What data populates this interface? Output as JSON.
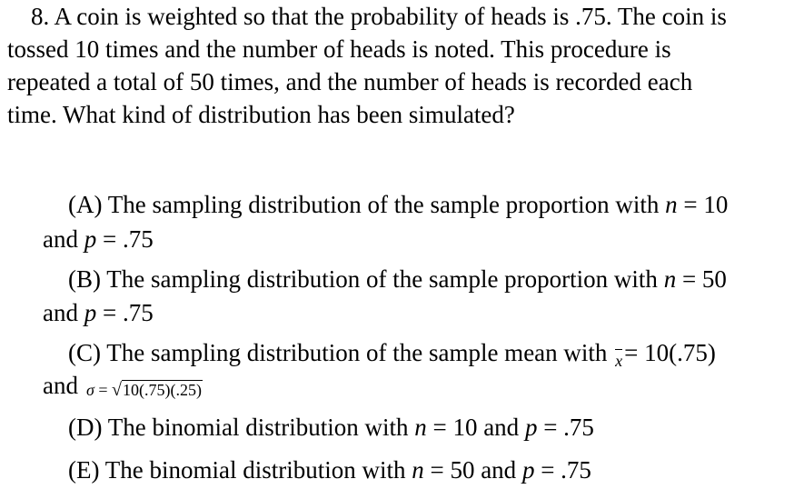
{
  "question": {
    "number": "8.",
    "lines": [
      "A coin is weighted so that the probability of heads is .75. The coin is",
      "tossed 10 times and the number of heads is noted. This procedure is",
      "repeated a total of 50 times, and the number of heads is recorded each",
      "time. What kind of distribution has been simulated?"
    ]
  },
  "choices": {
    "A": {
      "label": "(A) The sampling distribution of the sample proportion with",
      "n_sym": "n",
      "n_eq": " = 10",
      "and": "and ",
      "p_sym": "p",
      "p_eq": " = .75"
    },
    "B": {
      "label": "(B) The sampling distribution of the sample proportion with",
      "n_sym": "n",
      "n_eq": " = 50",
      "and": "and ",
      "p_sym": "p",
      "p_eq": " = .75"
    },
    "C": {
      "label": "(C) The sampling distribution of the sample mean with",
      "x_sym": "x",
      "mean_eq": "= 10(.75)",
      "and": "and",
      "sigma_sym": "σ",
      "sigma_eq": " = ",
      "sqrt": "√",
      "radicand": "10(.75)(.25)"
    },
    "D": {
      "label": "(D) The binomial distribution with ",
      "n_sym": "n",
      "n_eq": " = 10 and ",
      "p_sym": "p",
      "p_eq": " = .75"
    },
    "E": {
      "label": "(E) The binomial distribution with ",
      "n_sym": "n",
      "n_eq": " = 50 and ",
      "p_sym": "p",
      "p_eq": " = .75"
    }
  }
}
